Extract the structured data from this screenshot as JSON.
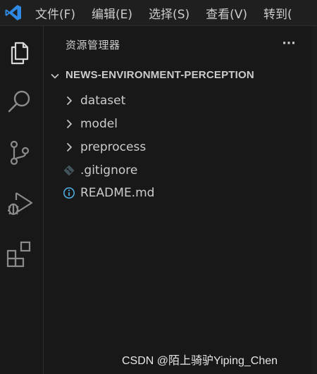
{
  "menu": {
    "items": [
      {
        "label": "文件(F)"
      },
      {
        "label": "编辑(E)"
      },
      {
        "label": "选择(S)"
      },
      {
        "label": "查看(V)"
      },
      {
        "label": "转到("
      }
    ]
  },
  "activity_bar": {
    "icons": [
      "files-icon",
      "search-icon",
      "source-control-icon",
      "run-debug-icon",
      "extensions-icon"
    ]
  },
  "explorer": {
    "title": "资源管理器",
    "more_label": "···",
    "root_folder": "NEWS-ENVIRONMENT-PERCEPTION",
    "items": [
      {
        "label": "dataset",
        "icon": "chevron-right-icon"
      },
      {
        "label": "model",
        "icon": "chevron-right-icon"
      },
      {
        "label": "preprocess",
        "icon": "chevron-right-icon"
      },
      {
        "label": ".gitignore",
        "icon": "git-diamond-icon"
      },
      {
        "label": "README.md",
        "icon": "info-icon"
      }
    ]
  },
  "watermark": "CSDN @陌上骑驴Yiping_Chen",
  "colors": {
    "accent": "#2f8ae6",
    "text": "#cccccc",
    "info": "#4fb3e8"
  }
}
